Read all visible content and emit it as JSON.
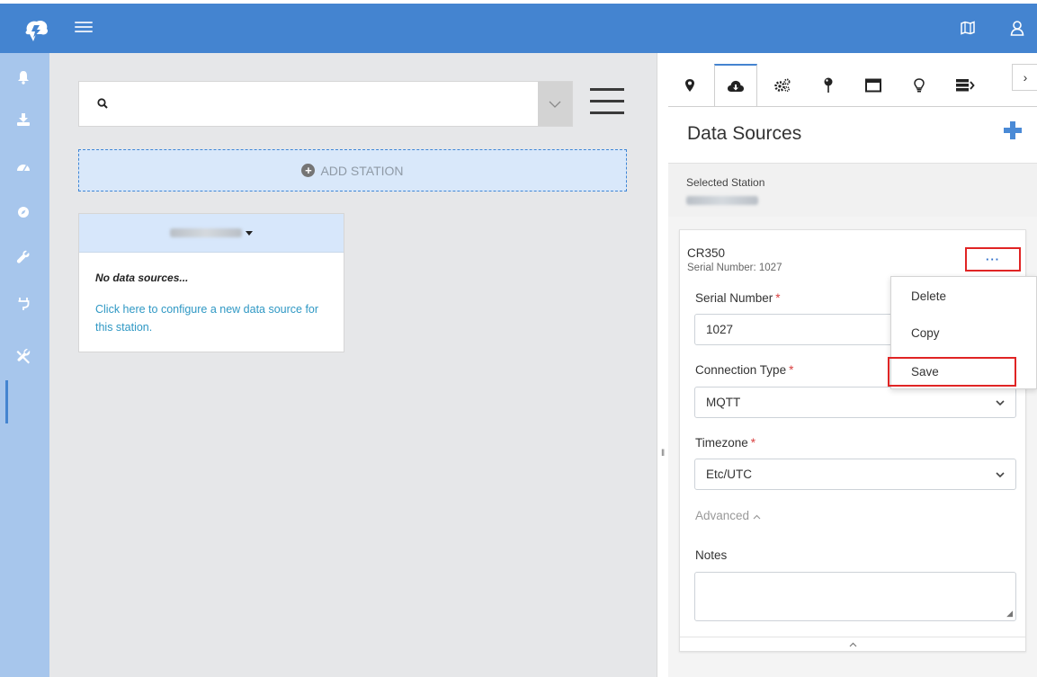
{
  "topbar": {
    "logo_icon": "cloud-logo-icon",
    "menu_icon": "hamburger-icon",
    "map_icon": "map-icon",
    "user_icon": "user-icon",
    "brand_color": "#4484d0"
  },
  "sidebar": {
    "items": [
      {
        "icon": "bell-icon"
      },
      {
        "icon": "download-icon"
      },
      {
        "icon": "dashboard-icon"
      },
      {
        "icon": "compass-icon"
      },
      {
        "icon": "wrench-icon"
      },
      {
        "icon": "plug-icon"
      },
      {
        "icon": "tools-icon",
        "active": true
      }
    ]
  },
  "main": {
    "search": {
      "value": "",
      "placeholder": ""
    },
    "add_station_label": "ADD STATION",
    "station_card": {
      "no_sources": "No data sources...",
      "configure_link": "Click here to configure a new data source for this station."
    }
  },
  "panel": {
    "tabs": [
      {
        "icon": "location-pin-icon"
      },
      {
        "icon": "cloud-download-icon",
        "active": true
      },
      {
        "icon": "gears-icon"
      },
      {
        "icon": "map-pin-icon"
      },
      {
        "icon": "window-icon"
      },
      {
        "icon": "lightbulb-icon"
      },
      {
        "icon": "server-icon"
      }
    ],
    "tab_next": "›",
    "title": "Data Sources",
    "add_icon": "plus-icon",
    "selected_station_label": "Selected Station",
    "data_source": {
      "name": "CR350",
      "serial_sub": "Serial Number: 1027",
      "more_label": "···",
      "serial_label": "Serial Number",
      "serial_value": "1027",
      "connection_label": "Connection Type",
      "connection_value": "MQTT",
      "timezone_label": "Timezone",
      "timezone_value": "Etc/UTC",
      "advanced_label": "Advanced",
      "notes_label": "Notes",
      "required_mark": "*"
    },
    "menu": {
      "delete": "Delete",
      "copy": "Copy",
      "save": "Save"
    }
  }
}
